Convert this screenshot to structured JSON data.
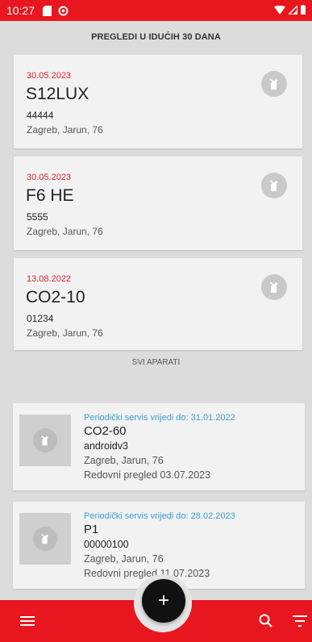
{
  "status_bar": {
    "time": "10:27"
  },
  "upcoming": {
    "header": "PREGLEDI U IDUĆIH 30 DANA",
    "cards": [
      {
        "date": "30.05.2023",
        "name": "S12LUX",
        "serial": "44444",
        "location": "Zagreb, Jarun, 76"
      },
      {
        "date": "30.05.2023",
        "name": "F6 HE",
        "serial": "5555",
        "location": "Zagreb, Jarun, 76"
      },
      {
        "date": "13.08.2022",
        "name": "CO2-10",
        "serial": "01234",
        "location": "Zagreb, Jarun, 76"
      }
    ]
  },
  "all_devices": {
    "label": "SVI APARATI",
    "items": [
      {
        "service": "Periodički servis vrijedi do: 31.01.2022",
        "name": "CO2-60",
        "serial": "androidv3",
        "location": "Zagreb, Jarun, 76",
        "regular": "Redovni pregled 03.07.2023"
      },
      {
        "service": "Periodički servis vrijedi do: 28.02.2023",
        "name": "P1",
        "serial": "00000100",
        "location": "Zagreb, Jarun, 76",
        "regular": "Redovni pregled 11.07.2023"
      }
    ]
  },
  "colors": {
    "accent": "#e8161f",
    "date_red": "#e3242b",
    "service_blue": "#3a9fd0"
  },
  "fab": {
    "label": "+"
  },
  "bottom_bar": {
    "icons": [
      "menu-icon",
      "search-icon",
      "filter-icon"
    ]
  }
}
